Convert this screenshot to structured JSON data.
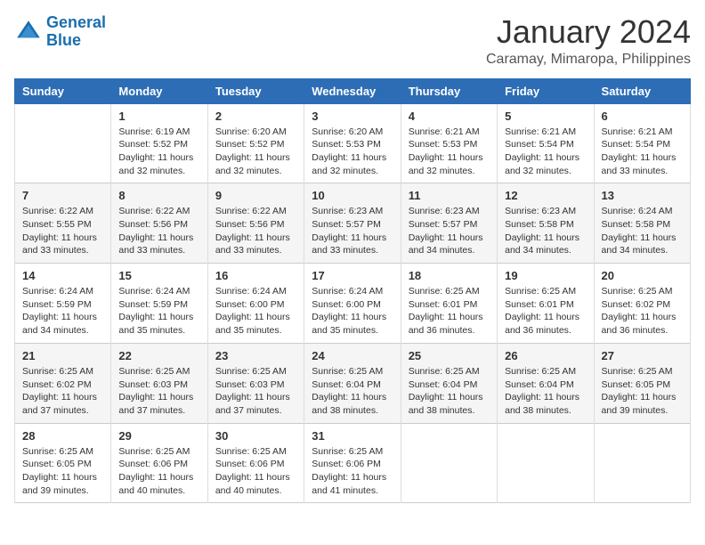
{
  "logo": {
    "line1": "General",
    "line2": "Blue"
  },
  "title": "January 2024",
  "subtitle": "Caramay, Mimaropa, Philippines",
  "days_of_week": [
    "Sunday",
    "Monday",
    "Tuesday",
    "Wednesday",
    "Thursday",
    "Friday",
    "Saturday"
  ],
  "weeks": [
    [
      {
        "day": "",
        "info": ""
      },
      {
        "day": "1",
        "info": "Sunrise: 6:19 AM\nSunset: 5:52 PM\nDaylight: 11 hours\nand 32 minutes."
      },
      {
        "day": "2",
        "info": "Sunrise: 6:20 AM\nSunset: 5:52 PM\nDaylight: 11 hours\nand 32 minutes."
      },
      {
        "day": "3",
        "info": "Sunrise: 6:20 AM\nSunset: 5:53 PM\nDaylight: 11 hours\nand 32 minutes."
      },
      {
        "day": "4",
        "info": "Sunrise: 6:21 AM\nSunset: 5:53 PM\nDaylight: 11 hours\nand 32 minutes."
      },
      {
        "day": "5",
        "info": "Sunrise: 6:21 AM\nSunset: 5:54 PM\nDaylight: 11 hours\nand 32 minutes."
      },
      {
        "day": "6",
        "info": "Sunrise: 6:21 AM\nSunset: 5:54 PM\nDaylight: 11 hours\nand 33 minutes."
      }
    ],
    [
      {
        "day": "7",
        "info": "Sunrise: 6:22 AM\nSunset: 5:55 PM\nDaylight: 11 hours\nand 33 minutes."
      },
      {
        "day": "8",
        "info": "Sunrise: 6:22 AM\nSunset: 5:56 PM\nDaylight: 11 hours\nand 33 minutes."
      },
      {
        "day": "9",
        "info": "Sunrise: 6:22 AM\nSunset: 5:56 PM\nDaylight: 11 hours\nand 33 minutes."
      },
      {
        "day": "10",
        "info": "Sunrise: 6:23 AM\nSunset: 5:57 PM\nDaylight: 11 hours\nand 33 minutes."
      },
      {
        "day": "11",
        "info": "Sunrise: 6:23 AM\nSunset: 5:57 PM\nDaylight: 11 hours\nand 34 minutes."
      },
      {
        "day": "12",
        "info": "Sunrise: 6:23 AM\nSunset: 5:58 PM\nDaylight: 11 hours\nand 34 minutes."
      },
      {
        "day": "13",
        "info": "Sunrise: 6:24 AM\nSunset: 5:58 PM\nDaylight: 11 hours\nand 34 minutes."
      }
    ],
    [
      {
        "day": "14",
        "info": "Sunrise: 6:24 AM\nSunset: 5:59 PM\nDaylight: 11 hours\nand 34 minutes."
      },
      {
        "day": "15",
        "info": "Sunrise: 6:24 AM\nSunset: 5:59 PM\nDaylight: 11 hours\nand 35 minutes."
      },
      {
        "day": "16",
        "info": "Sunrise: 6:24 AM\nSunset: 6:00 PM\nDaylight: 11 hours\nand 35 minutes."
      },
      {
        "day": "17",
        "info": "Sunrise: 6:24 AM\nSunset: 6:00 PM\nDaylight: 11 hours\nand 35 minutes."
      },
      {
        "day": "18",
        "info": "Sunrise: 6:25 AM\nSunset: 6:01 PM\nDaylight: 11 hours\nand 36 minutes."
      },
      {
        "day": "19",
        "info": "Sunrise: 6:25 AM\nSunset: 6:01 PM\nDaylight: 11 hours\nand 36 minutes."
      },
      {
        "day": "20",
        "info": "Sunrise: 6:25 AM\nSunset: 6:02 PM\nDaylight: 11 hours\nand 36 minutes."
      }
    ],
    [
      {
        "day": "21",
        "info": "Sunrise: 6:25 AM\nSunset: 6:02 PM\nDaylight: 11 hours\nand 37 minutes."
      },
      {
        "day": "22",
        "info": "Sunrise: 6:25 AM\nSunset: 6:03 PM\nDaylight: 11 hours\nand 37 minutes."
      },
      {
        "day": "23",
        "info": "Sunrise: 6:25 AM\nSunset: 6:03 PM\nDaylight: 11 hours\nand 37 minutes."
      },
      {
        "day": "24",
        "info": "Sunrise: 6:25 AM\nSunset: 6:04 PM\nDaylight: 11 hours\nand 38 minutes."
      },
      {
        "day": "25",
        "info": "Sunrise: 6:25 AM\nSunset: 6:04 PM\nDaylight: 11 hours\nand 38 minutes."
      },
      {
        "day": "26",
        "info": "Sunrise: 6:25 AM\nSunset: 6:04 PM\nDaylight: 11 hours\nand 38 minutes."
      },
      {
        "day": "27",
        "info": "Sunrise: 6:25 AM\nSunset: 6:05 PM\nDaylight: 11 hours\nand 39 minutes."
      }
    ],
    [
      {
        "day": "28",
        "info": "Sunrise: 6:25 AM\nSunset: 6:05 PM\nDaylight: 11 hours\nand 39 minutes."
      },
      {
        "day": "29",
        "info": "Sunrise: 6:25 AM\nSunset: 6:06 PM\nDaylight: 11 hours\nand 40 minutes."
      },
      {
        "day": "30",
        "info": "Sunrise: 6:25 AM\nSunset: 6:06 PM\nDaylight: 11 hours\nand 40 minutes."
      },
      {
        "day": "31",
        "info": "Sunrise: 6:25 AM\nSunset: 6:06 PM\nDaylight: 11 hours\nand 41 minutes."
      },
      {
        "day": "",
        "info": ""
      },
      {
        "day": "",
        "info": ""
      },
      {
        "day": "",
        "info": ""
      }
    ]
  ]
}
